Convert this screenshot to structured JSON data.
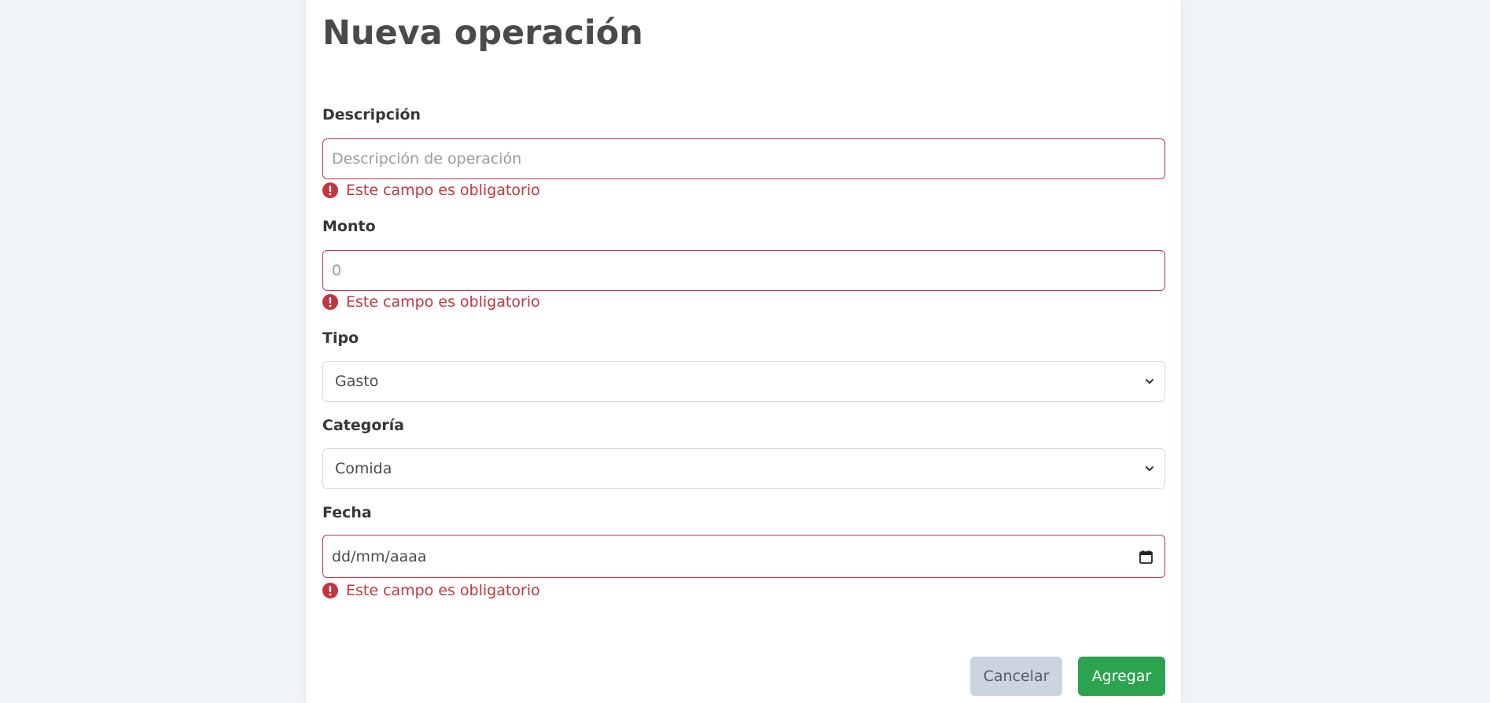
{
  "form": {
    "title": "Nueva operación",
    "descripcion": {
      "label": "Descripción",
      "placeholder": "Descripción de operación",
      "value": "",
      "error": "Este campo es obligatorio"
    },
    "monto": {
      "label": "Monto",
      "placeholder": "0",
      "value": "",
      "error": "Este campo es obligatorio"
    },
    "tipo": {
      "label": "Tipo",
      "selected": "Gasto"
    },
    "categoria": {
      "label": "Categoría",
      "selected": "Comida"
    },
    "fecha": {
      "label": "Fecha",
      "placeholder": "dd/mm/aaaa",
      "error": "Este campo es obligatorio"
    },
    "buttons": {
      "cancel_label": "Cancelar",
      "add_label": "Agregar"
    }
  },
  "colors": {
    "page_background": "#f0f3f8",
    "error": "#c2353f",
    "primary_button": "#2ca44f",
    "secondary_button": "#cbd5df"
  },
  "icons": {
    "error": "exclamation-circle-icon",
    "select": "chevron-down-icon",
    "date": "calendar-icon"
  }
}
